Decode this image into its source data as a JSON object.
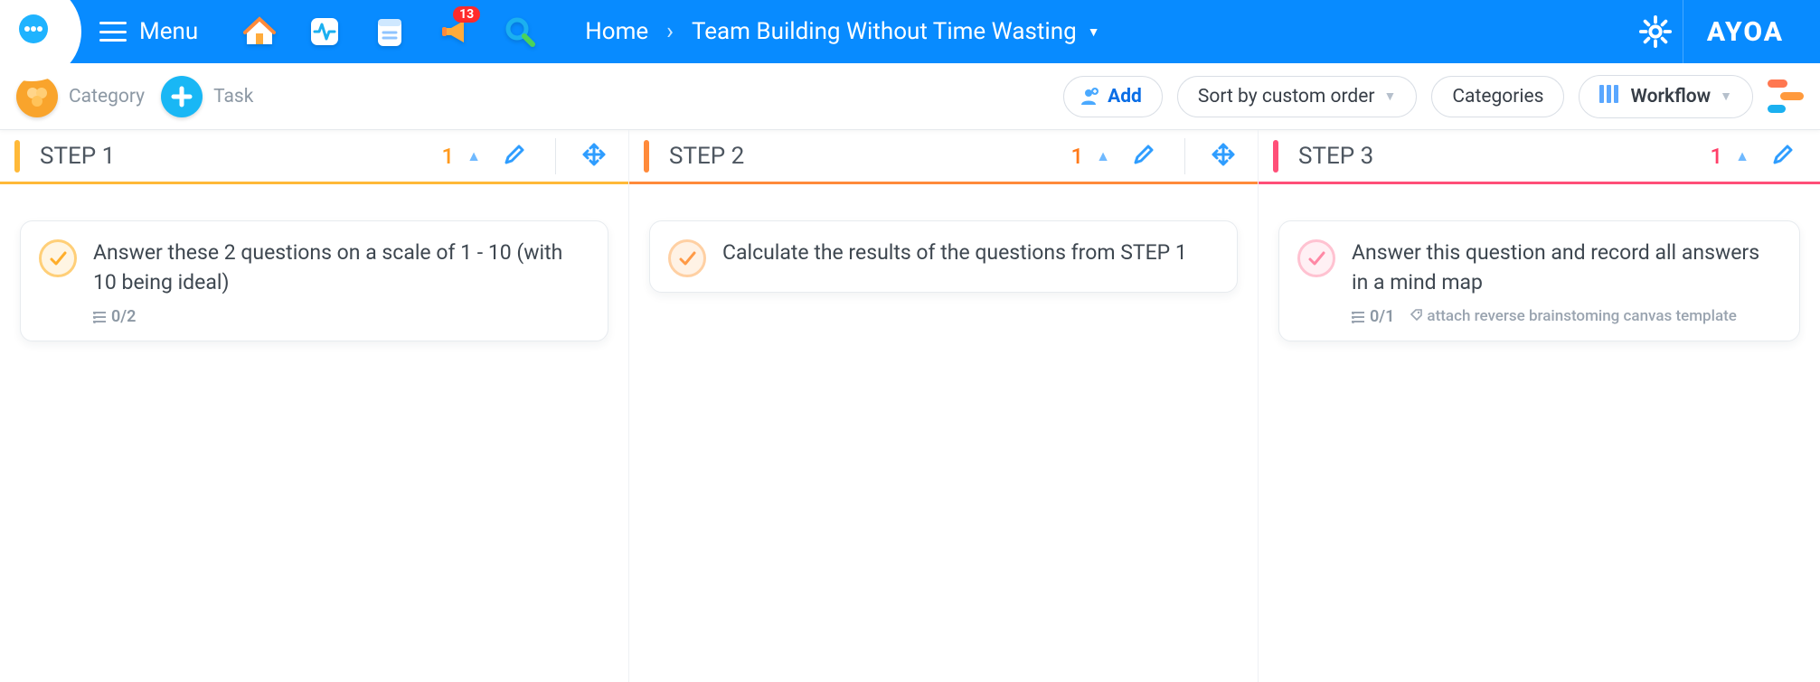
{
  "nav": {
    "menu_label": "Menu",
    "notif_count": "13",
    "breadcrumb_home": "Home",
    "breadcrumb_title": "Team Building Without Time Wasting",
    "brand": "AYOA"
  },
  "toolbar": {
    "category_label": "Category",
    "task_label": "Task",
    "add_label": "Add",
    "sort_label": "Sort by custom order",
    "categories_label": "Categories",
    "workflow_label": "Workflow"
  },
  "columns": [
    {
      "title": "STEP 1",
      "count": "1",
      "task": {
        "title": "Answer these 2 questions on a scale of 1 - 10 (with 10 being ideal)",
        "checklist": "0/2",
        "tag": ""
      }
    },
    {
      "title": "STEP 2",
      "count": "1",
      "task": {
        "title": "Calculate the results of the questions from STEP 1",
        "checklist": "",
        "tag": ""
      }
    },
    {
      "title": "STEP 3",
      "count": "1",
      "task": {
        "title": "Answer this question and record all answers in a mind map",
        "checklist": "0/1",
        "tag": "attach reverse brainstoming canvas template"
      }
    }
  ]
}
